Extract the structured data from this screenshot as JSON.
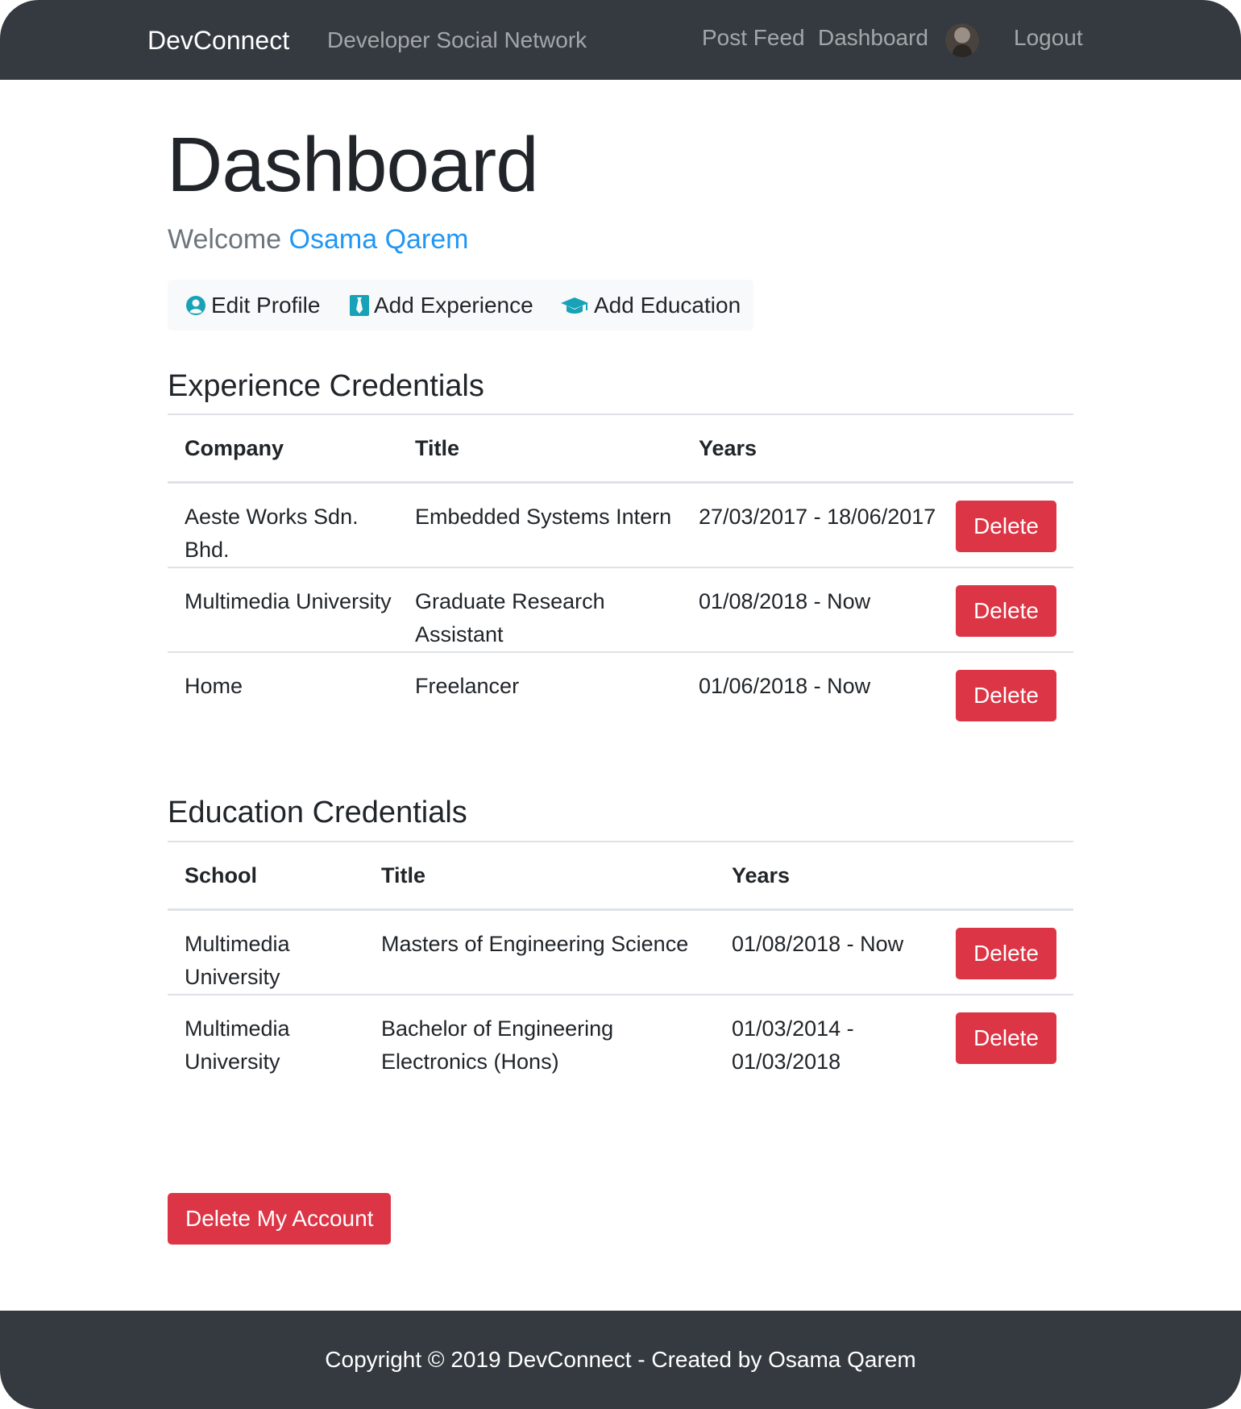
{
  "navbar": {
    "brand": "DevConnect",
    "tagline": "Developer Social Network",
    "links": {
      "post_feed": "Post Feed",
      "dashboard": "Dashboard",
      "logout": "Logout"
    }
  },
  "main": {
    "title": "Dashboard",
    "welcome_prefix": "Welcome",
    "user_name": "Osama Qarem",
    "actions": {
      "edit_profile": "Edit Profile",
      "add_experience": "Add Experience",
      "add_education": "Add Education"
    }
  },
  "experience": {
    "heading": "Experience Credentials",
    "columns": [
      "Company",
      "Title",
      "Years"
    ],
    "rows": [
      {
        "company": "Aeste Works Sdn. Bhd.",
        "title": "Embedded Systems Intern",
        "years": "27/03/2017 - 18/06/2017",
        "action": "Delete"
      },
      {
        "company": "Multimedia University",
        "title": "Graduate Research Assistant",
        "years": "01/08/2018 - Now",
        "action": "Delete"
      },
      {
        "company": "Home",
        "title": "Freelancer",
        "years": "01/06/2018 - Now",
        "action": "Delete"
      }
    ]
  },
  "education": {
    "heading": "Education Credentials",
    "columns": [
      "School",
      "Title",
      "Years"
    ],
    "rows": [
      {
        "school": "Multimedia University",
        "title": "Masters of Engineering Science",
        "years": "01/08/2018 - Now",
        "action": "Delete"
      },
      {
        "school": "Multimedia University",
        "title": "Bachelor of Engineering Electronics (Hons)",
        "years": "01/03/2014 - 01/03/2018",
        "action": "Delete"
      }
    ]
  },
  "delete_account": "Delete My Account",
  "footer": {
    "text": "Copyright © 2019 DevConnect - Created by Osama Qarem"
  },
  "colors": {
    "navbar_bg": "#343a40",
    "danger": "#dc3545",
    "link": "#2196f3",
    "icon_accent": "#17a2b8"
  },
  "icons": {
    "edit_profile": "user-circle-icon",
    "add_experience": "black-tie-icon",
    "add_education": "graduation-cap-icon"
  }
}
